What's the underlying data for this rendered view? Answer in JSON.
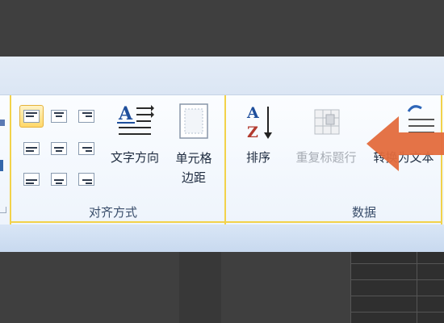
{
  "ribbon": {
    "groups": [
      {
        "label": "对齐方式",
        "buttons": [
          {
            "label": "文字方向"
          },
          {
            "label_line1": "单元格",
            "label_line2": "边距"
          }
        ]
      },
      {
        "label": "数据",
        "buttons": [
          {
            "label": "排序"
          },
          {
            "label": "重复标题行",
            "state": "disabled"
          },
          {
            "label_partial": "转换为文本"
          }
        ]
      }
    ]
  },
  "colors": {
    "accent_arrow": "#e36b3d",
    "selected_fill": "#ffd86a",
    "ribbon_label": "#3a4e6b"
  }
}
